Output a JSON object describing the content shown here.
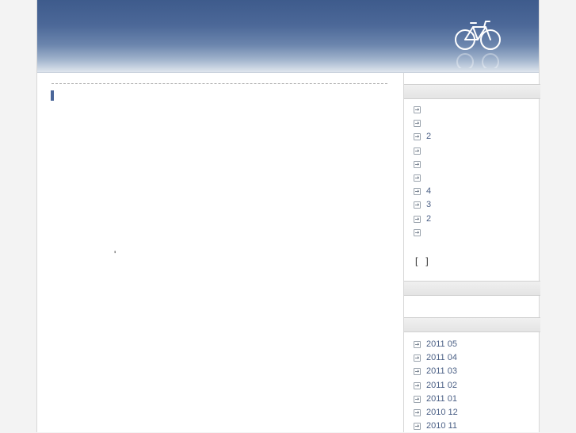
{
  "main": {
    "title": "",
    "body_mark": "'"
  },
  "sidebar": {
    "categories": [
      {
        "label": "",
        "count": ""
      },
      {
        "label": "",
        "count": ""
      },
      {
        "label": "",
        "count": "2"
      },
      {
        "label": "",
        "count": ""
      },
      {
        "label": "",
        "count": ""
      },
      {
        "label": "",
        "count": ""
      },
      {
        "label": "",
        "count": "4"
      },
      {
        "label": "",
        "count": "3"
      },
      {
        "label": "",
        "count": "2"
      },
      {
        "label": "",
        "count": ""
      }
    ],
    "more_open": "[",
    "more_close": "]",
    "archives": [
      "2011 05",
      "2011 04",
      "2011 03",
      "2011 02",
      "2011 01",
      "2010 12",
      "2010 11"
    ]
  },
  "colors": {
    "header_top": "#3e5b8c",
    "accent": "#4a6699",
    "link": "#4a5f85"
  },
  "icons": {
    "header_logo": "bicycle-icon",
    "list_bullet": "arrow-box-icon"
  }
}
